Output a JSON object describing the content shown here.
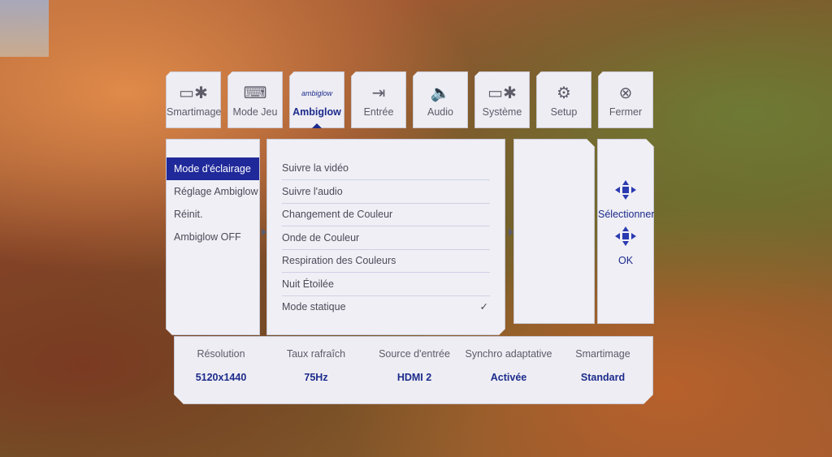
{
  "tabs": [
    {
      "label": "Smartimage",
      "icon": "smartimage-icon",
      "glyph": "▭✱"
    },
    {
      "label": "Mode Jeu",
      "icon": "gamepad-icon",
      "glyph": "⌨"
    },
    {
      "label": "Ambiglow",
      "icon": "ambiglow-icon",
      "glyph": "◌",
      "icon_text": "ambiglow"
    },
    {
      "label": "Entrée",
      "icon": "input-icon",
      "glyph": "⇥"
    },
    {
      "label": "Audio",
      "icon": "speaker-icon",
      "glyph": "🔈"
    },
    {
      "label": "Système",
      "icon": "system-icon",
      "glyph": "▭✱"
    },
    {
      "label": "Setup",
      "icon": "gear-icon",
      "glyph": "⚙"
    },
    {
      "label": "Fermer",
      "icon": "close-icon",
      "glyph": "⊗"
    }
  ],
  "active_tab": "Ambiglow",
  "left_menu": [
    {
      "label": "Mode d'éclairage"
    },
    {
      "label": "Réglage Ambiglow"
    },
    {
      "label": "Réinit."
    },
    {
      "label": "Ambiglow OFF"
    }
  ],
  "selected_left": "Mode d'éclairage",
  "options": [
    {
      "label": "Suivre la vidéo"
    },
    {
      "label": "Suivre l'audio"
    },
    {
      "label": "Changement de Couleur"
    },
    {
      "label": "Onde de Couleur"
    },
    {
      "label": "Respiration des Couleurs"
    },
    {
      "label": "Nuit Étoilée"
    },
    {
      "label": "Mode statique",
      "check": "✓"
    }
  ],
  "nav": {
    "select_label": "Sélectionner",
    "ok_label": "OK",
    "select_icon": "four-way-arrows-icon",
    "ok_icon": "ok-arrows-icon"
  },
  "status": [
    {
      "header": "Résolution",
      "value": "5120x1440"
    },
    {
      "header": "Taux rafraîch",
      "value": "75Hz"
    },
    {
      "header": "Source d'entrée",
      "value": "HDMI 2"
    },
    {
      "header": "Synchro adaptative",
      "value": "Activée"
    },
    {
      "header": "Smartimage",
      "value": "Standard"
    }
  ],
  "colors": {
    "accent": "#20299a",
    "panel": "#f0eff5",
    "text": "#4c4a58"
  }
}
